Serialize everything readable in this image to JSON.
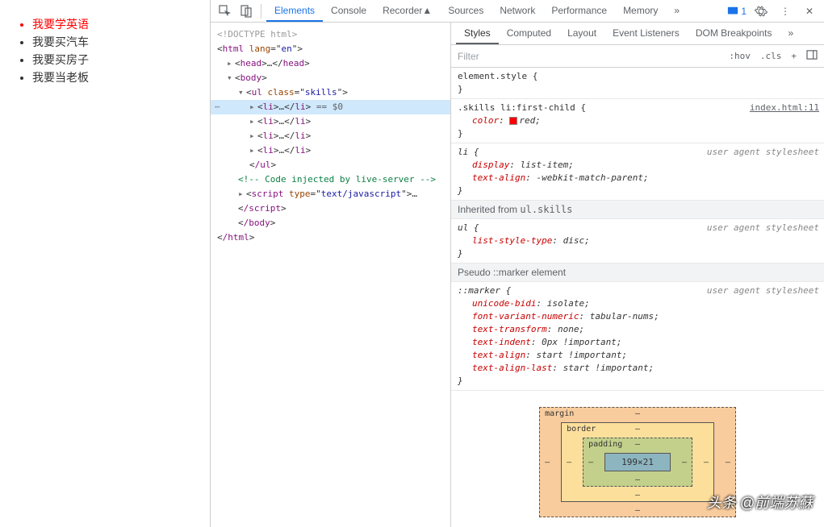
{
  "page": {
    "list_items": [
      "我要学英语",
      "我要买汽车",
      "我要买房子",
      "我要当老板"
    ]
  },
  "devtools": {
    "top_tabs": [
      "Elements",
      "Console",
      "Recorder",
      "Sources",
      "Network",
      "Performance",
      "Memory"
    ],
    "error_count": "1",
    "elements": {
      "doctype": "<!DOCTYPE html>",
      "html_open": "html",
      "html_lang_attr": "lang",
      "html_lang_val": "en",
      "head": "head",
      "body": "body",
      "ul": "ul",
      "ul_class_attr": "class",
      "ul_class_val": "skills",
      "li": "li",
      "ellipsis": "…",
      "selected_suffix": " == $0",
      "ul_close": "/ul",
      "comment": " Code injected by live-server ",
      "script": "script",
      "script_type_attr": "type",
      "script_type_val": "text/javascript",
      "script_close": "/script",
      "body_close": "/body",
      "html_close": "/html"
    },
    "styles": {
      "tabs": [
        "Styles",
        "Computed",
        "Layout",
        "Event Listeners",
        "DOM Breakpoints"
      ],
      "filter_placeholder": "Filter",
      "hov": ":hov",
      "cls": ".cls",
      "rules": {
        "element_style_sel": "element.style",
        "skills_sel": ".skills li:first-child",
        "skills_src": "index.html:11",
        "skills_decl_prop": "color",
        "skills_decl_val": "red",
        "li_sel": "li",
        "ua_label": "user agent stylesheet",
        "li_decls": [
          {
            "p": "display",
            "v": "list-item"
          },
          {
            "p": "text-align",
            "v": "-webkit-match-parent"
          }
        ],
        "inherited_label": "Inherited from ",
        "inherited_from": "ul.skills",
        "ul_sel": "ul",
        "ul_decls": [
          {
            "p": "list-style-type",
            "v": "disc"
          }
        ],
        "pseudo_label": "Pseudo ::marker element",
        "marker_sel": "::marker",
        "marker_decls": [
          {
            "p": "unicode-bidi",
            "v": "isolate"
          },
          {
            "p": "font-variant-numeric",
            "v": "tabular-nums"
          },
          {
            "p": "text-transform",
            "v": "none"
          },
          {
            "p": "text-indent",
            "v": "0px !important"
          },
          {
            "p": "text-align",
            "v": "start !important"
          },
          {
            "p": "text-align-last",
            "v": "start !important"
          }
        ]
      },
      "box": {
        "margin": "margin",
        "border": "border",
        "padding": "padding",
        "dash": "–",
        "content": "199×21"
      }
    }
  },
  "watermark": "头条 @前端苏蘇"
}
